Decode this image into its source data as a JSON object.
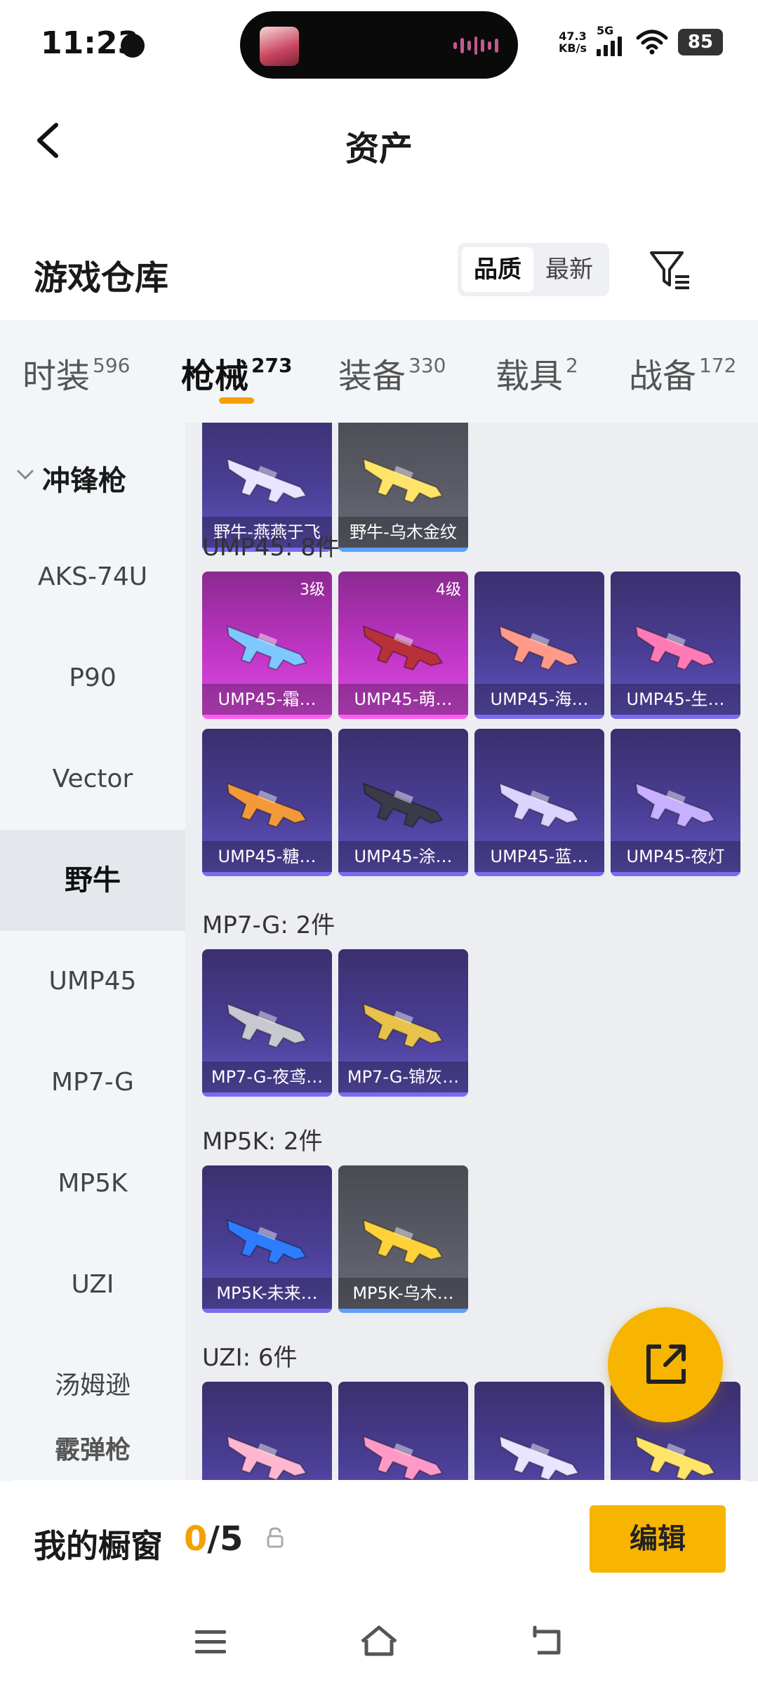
{
  "status_bar": {
    "time": "11:23",
    "speed_value": "47.3",
    "speed_unit": "KB/s",
    "network": "5G",
    "battery": "85"
  },
  "header": {
    "title": "资产"
  },
  "warehouse": {
    "title": "游戏仓库",
    "sort_options": [
      "品质",
      "最新"
    ],
    "active_sort": "品质"
  },
  "tabs": [
    {
      "label": "时装",
      "count": "596"
    },
    {
      "label": "枪械",
      "count": "273"
    },
    {
      "label": "装备",
      "count": "330"
    },
    {
      "label": "载具",
      "count": "2"
    },
    {
      "label": "战备",
      "count": "172"
    }
  ],
  "active_tab": "枪械",
  "sidebar": {
    "group": "冲锋枪",
    "items": [
      "AKS-74U",
      "P90",
      "Vector",
      "野牛",
      "UMP45",
      "MP7-G",
      "MP5K",
      "UZI",
      "汤姆逊"
    ],
    "active": "野牛",
    "next_group_partial": "霰弹枪"
  },
  "sections": [
    {
      "title": "",
      "cards": [
        {
          "label": "野牛-燕燕于飞",
          "level": "",
          "rarity": "purple"
        },
        {
          "label": "野牛-乌木金纹",
          "level": "",
          "rarity": "gray"
        }
      ]
    },
    {
      "title": "UMP45: 8件",
      "cards": [
        {
          "label": "UMP45-霜…",
          "level": "3级",
          "rarity": "pink"
        },
        {
          "label": "UMP45-萌…",
          "level": "4级",
          "rarity": "pink"
        },
        {
          "label": "UMP45-海…",
          "level": "",
          "rarity": "purple"
        },
        {
          "label": "UMP45-生…",
          "level": "",
          "rarity": "purple"
        },
        {
          "label": "UMP45-糖…",
          "level": "",
          "rarity": "purple"
        },
        {
          "label": "UMP45-涂…",
          "level": "",
          "rarity": "purple"
        },
        {
          "label": "UMP45-蓝…",
          "level": "",
          "rarity": "purple"
        },
        {
          "label": "UMP45-夜灯",
          "level": "",
          "rarity": "purple"
        }
      ]
    },
    {
      "title": "MP7-G: 2件",
      "cards": [
        {
          "label": "MP7-G-夜鸢…",
          "level": "",
          "rarity": "purple"
        },
        {
          "label": "MP7-G-锦灰…",
          "level": "",
          "rarity": "purple"
        }
      ]
    },
    {
      "title": "MP5K: 2件",
      "cards": [
        {
          "label": "MP5K-未来…",
          "level": "",
          "rarity": "purple"
        },
        {
          "label": "MP5K-乌木…",
          "level": "",
          "rarity": "gray"
        }
      ]
    },
    {
      "title": "UZI: 6件",
      "cards": [
        {
          "label": "",
          "level": "",
          "rarity": "purple"
        },
        {
          "label": "",
          "level": "",
          "rarity": "purple"
        },
        {
          "label": "",
          "level": "",
          "rarity": "purple"
        },
        {
          "label": "",
          "level": "",
          "rarity": "purple"
        }
      ]
    }
  ],
  "showcase": {
    "label": "我的橱窗",
    "count": "0",
    "total": "/5",
    "edit_label": "编辑"
  },
  "colors": {
    "accent": "#f7b400",
    "purple_card": "#4a3e95",
    "pink_card": "#c135c6",
    "gray_card": "#5c5d68"
  },
  "icons": {
    "back": "back-arrow-icon",
    "filter": "filter-icon",
    "fab": "share-export-icon",
    "lock": "lock-icon",
    "nav": [
      "menu-icon",
      "home-icon",
      "back-nav-icon"
    ]
  }
}
